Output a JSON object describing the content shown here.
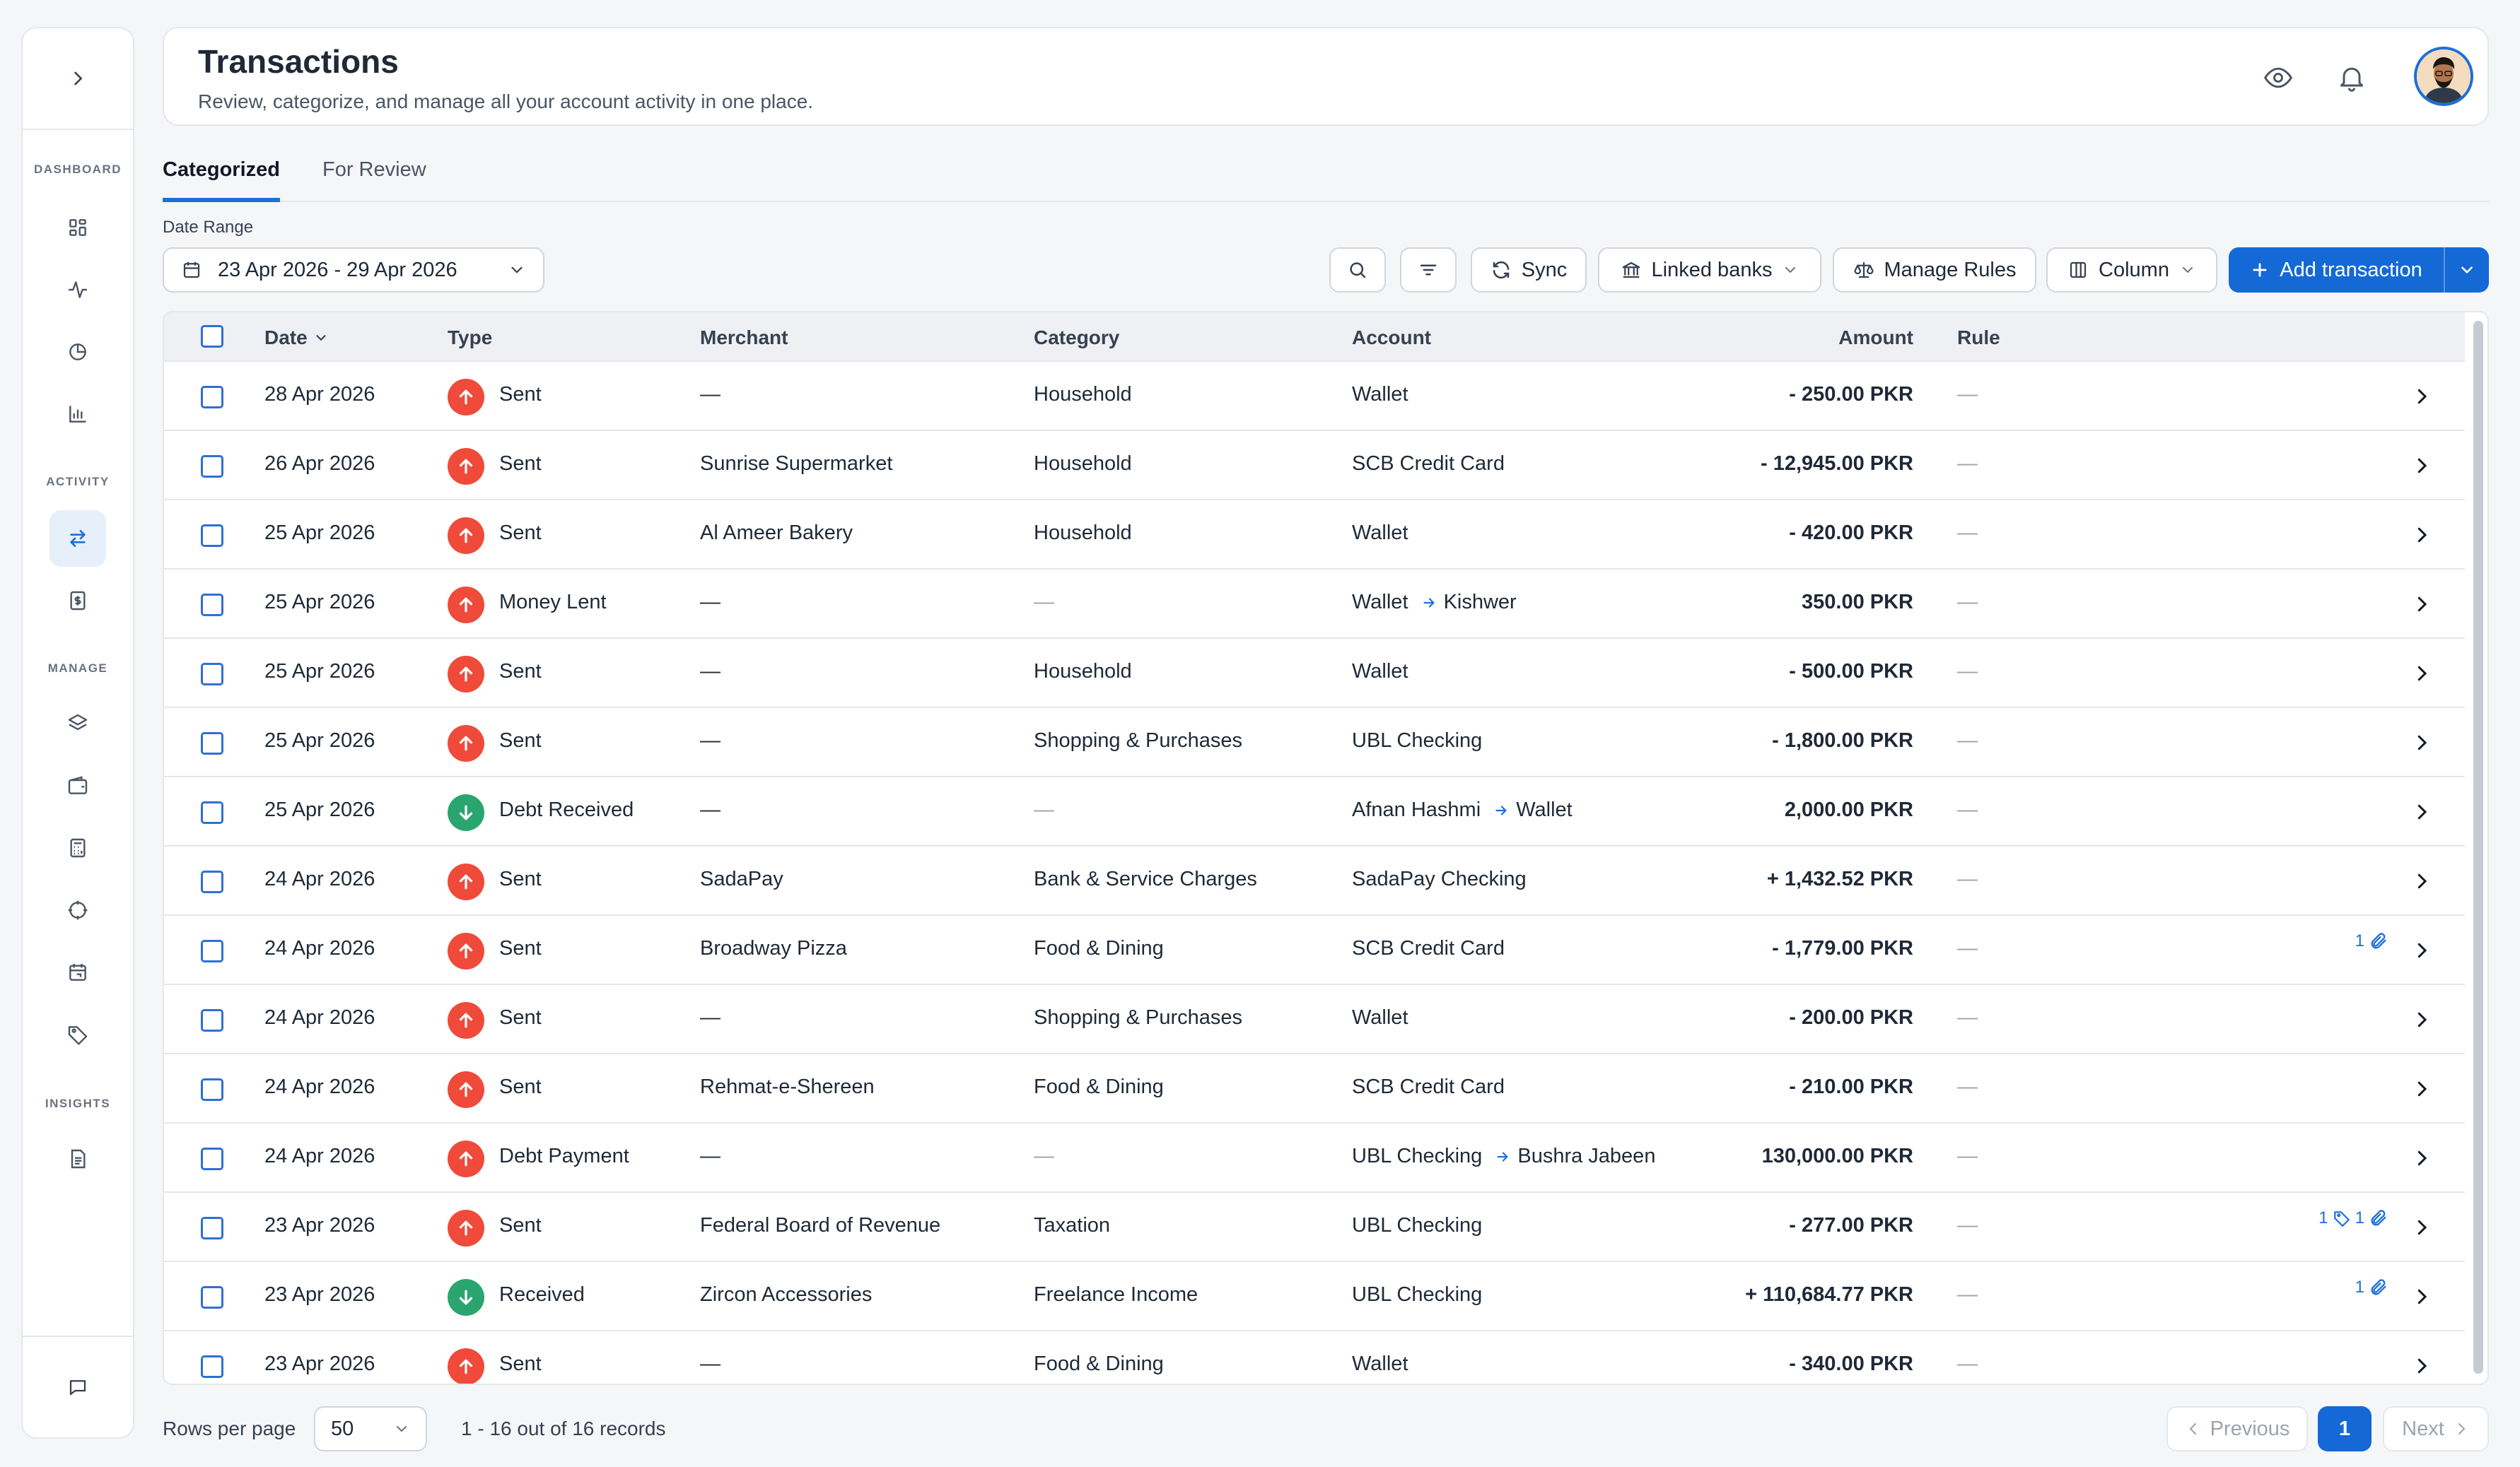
{
  "sidebar": {
    "sections": [
      {
        "label": "DASHBOARD",
        "items": [
          "dashboard-grid-icon",
          "activity-pulse-icon",
          "pie-chart-icon",
          "bar-chart-icon"
        ]
      },
      {
        "label": "ACTIVITY",
        "items": [
          "transactions-arrows-icon",
          "statement-icon"
        ]
      },
      {
        "label": "MANAGE",
        "items": [
          "layers-icon",
          "wallet-icon",
          "calculator-icon",
          "target-icon",
          "calendar-icon",
          "tag-icon"
        ]
      },
      {
        "label": "INSIGHTS",
        "items": [
          "report-icon"
        ]
      }
    ],
    "active_item": "transactions-arrows-icon"
  },
  "header": {
    "title": "Transactions",
    "subtitle": "Review, categorize, and manage all your account activity in one place."
  },
  "tabs": [
    {
      "label": "Categorized",
      "active": true
    },
    {
      "label": "For Review",
      "active": false
    }
  ],
  "toolbar": {
    "date_label": "Date Range",
    "date_value": "23 Apr 2026 - 29 Apr 2026",
    "sync_label": "Sync",
    "linked_banks_label": "Linked banks",
    "manage_rules_label": "Manage Rules",
    "column_label": "Column",
    "add_label": "Add transaction"
  },
  "table": {
    "columns": {
      "date": "Date",
      "type": "Type",
      "merchant": "Merchant",
      "category": "Category",
      "account": "Account",
      "amount": "Amount",
      "rule": "Rule"
    },
    "rows": [
      {
        "date": "28 Apr 2026",
        "direction": "out",
        "type": "Sent",
        "merchant": "—",
        "category": "Household",
        "account": "Wallet",
        "account_to": "",
        "amount": "- 250.00 PKR",
        "rule": "—",
        "tags": "",
        "attachments": ""
      },
      {
        "date": "26 Apr 2026",
        "direction": "out",
        "type": "Sent",
        "merchant": "Sunrise Supermarket",
        "category": "Household",
        "account": "SCB Credit Card",
        "account_to": "",
        "amount": "- 12,945.00 PKR",
        "rule": "—",
        "tags": "",
        "attachments": ""
      },
      {
        "date": "25 Apr 2026",
        "direction": "out",
        "type": "Sent",
        "merchant": "Al Ameer Bakery",
        "category": "Household",
        "account": "Wallet",
        "account_to": "",
        "amount": "- 420.00 PKR",
        "rule": "—",
        "tags": "",
        "attachments": ""
      },
      {
        "date": "25 Apr 2026",
        "direction": "out",
        "type": "Money Lent",
        "merchant": "—",
        "category": "—",
        "account": "Wallet",
        "account_to": "Kishwer",
        "amount": "350.00 PKR",
        "rule": "—",
        "tags": "",
        "attachments": ""
      },
      {
        "date": "25 Apr 2026",
        "direction": "out",
        "type": "Sent",
        "merchant": "—",
        "category": "Household",
        "account": "Wallet",
        "account_to": "",
        "amount": "- 500.00 PKR",
        "rule": "—",
        "tags": "",
        "attachments": ""
      },
      {
        "date": "25 Apr 2026",
        "direction": "out",
        "type": "Sent",
        "merchant": "—",
        "category": "Shopping & Purchases",
        "account": "UBL Checking",
        "account_to": "",
        "amount": "- 1,800.00 PKR",
        "rule": "—",
        "tags": "",
        "attachments": ""
      },
      {
        "date": "25 Apr 2026",
        "direction": "in",
        "type": "Debt Received",
        "merchant": "—",
        "category": "—",
        "account": "Afnan Hashmi",
        "account_to": "Wallet",
        "amount": "2,000.00 PKR",
        "rule": "—",
        "tags": "",
        "attachments": ""
      },
      {
        "date": "24 Apr 2026",
        "direction": "out",
        "type": "Sent",
        "merchant": "SadaPay",
        "category": "Bank & Service Charges",
        "account": "SadaPay Checking",
        "account_to": "",
        "amount": "+ 1,432.52 PKR",
        "rule": "—",
        "tags": "",
        "attachments": ""
      },
      {
        "date": "24 Apr 2026",
        "direction": "out",
        "type": "Sent",
        "merchant": "Broadway Pizza",
        "category": "Food & Dining",
        "account": "SCB Credit Card",
        "account_to": "",
        "amount": "- 1,779.00 PKR",
        "rule": "—",
        "tags": "",
        "attachments": "1"
      },
      {
        "date": "24 Apr 2026",
        "direction": "out",
        "type": "Sent",
        "merchant": "—",
        "category": "Shopping & Purchases",
        "account": "Wallet",
        "account_to": "",
        "amount": "- 200.00 PKR",
        "rule": "—",
        "tags": "",
        "attachments": ""
      },
      {
        "date": "24 Apr 2026",
        "direction": "out",
        "type": "Sent",
        "merchant": "Rehmat-e-Shereen",
        "category": "Food & Dining",
        "account": "SCB Credit Card",
        "account_to": "",
        "amount": "- 210.00 PKR",
        "rule": "—",
        "tags": "",
        "attachments": ""
      },
      {
        "date": "24 Apr 2026",
        "direction": "out",
        "type": "Debt Payment",
        "merchant": "—",
        "category": "—",
        "account": "UBL Checking",
        "account_to": "Bushra Jabeen",
        "amount": "130,000.00 PKR",
        "rule": "—",
        "tags": "",
        "attachments": ""
      },
      {
        "date": "23 Apr 2026",
        "direction": "out",
        "type": "Sent",
        "merchant": "Federal Board of Revenue",
        "category": "Taxation",
        "account": "UBL Checking",
        "account_to": "",
        "amount": "- 277.00 PKR",
        "rule": "—",
        "tags": "1",
        "attachments": "1"
      },
      {
        "date": "23 Apr 2026",
        "direction": "in",
        "type": "Received",
        "merchant": "Zircon Accessories",
        "category": "Freelance Income",
        "account": "UBL Checking",
        "account_to": "",
        "amount": "+ 110,684.77 PKR",
        "rule": "—",
        "tags": "",
        "attachments": "1"
      },
      {
        "date": "23 Apr 2026",
        "direction": "out",
        "type": "Sent",
        "merchant": "—",
        "category": "Food & Dining",
        "account": "Wallet",
        "account_to": "",
        "amount": "- 340.00 PKR",
        "rule": "—",
        "tags": "",
        "attachments": ""
      }
    ]
  },
  "footer": {
    "rows_per_page_label": "Rows per page",
    "rows_per_page_value": "50",
    "records_text": "1 - 16 out of 16 records",
    "previous_label": "Previous",
    "current_page": "1",
    "next_label": "Next"
  },
  "colors": {
    "primary": "#1469d6",
    "sent": "#f04a3a",
    "received": "#2aa56f"
  }
}
